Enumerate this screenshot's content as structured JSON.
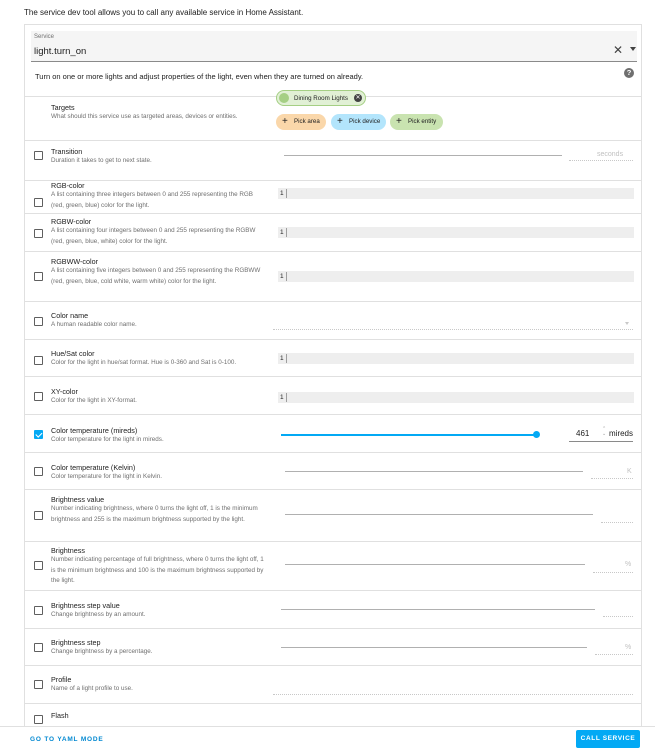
{
  "intro_text": "The service dev tool allows you to call any available service in Home Assistant.",
  "service": {
    "label": "Service",
    "value": "light.turn_on",
    "description": "Turn on one or more lights and adjust properties of the light, even when they are turned on already."
  },
  "targets": {
    "title": "Targets",
    "description": "What should this service use as targeted areas, devices or entities.",
    "selected_entity": "Dining Room Lights",
    "pick_area": "Pick area",
    "pick_device": "Pick device",
    "pick_entity": "Pick entity"
  },
  "fields": {
    "transition": {
      "title": "Transition",
      "description": "Duration it takes to get to next state.",
      "unit": "seconds",
      "checked": false
    },
    "rgb_color": {
      "title": "RGB-color",
      "description": "A list containing three integers between 0 and 255 representing the RGB (red, green, blue) color for the light.",
      "value": "1",
      "checked": false
    },
    "rgbw_color": {
      "title": "RGBW-color",
      "description": "A list containing four integers between 0 and 255 representing the RGBW (red, green, blue, white) color for the light.",
      "value": "1",
      "checked": false
    },
    "rgbww_color": {
      "title": "RGBWW-color",
      "description": "A list containing five integers between 0 and 255 representing the RGBWW (red, green, blue, cold white, warm white) color for the light.",
      "value": "1",
      "checked": false
    },
    "color_name": {
      "title": "Color name",
      "description": "A human readable color name.",
      "checked": false
    },
    "hs_color": {
      "title": "Hue/Sat color",
      "description": "Color for the light in hue/sat format. Hue is 0-360 and Sat is 0-100.",
      "value": "1",
      "checked": false
    },
    "xy_color": {
      "title": "XY-color",
      "description": "Color for the light in XY-format.",
      "value": "1",
      "checked": false
    },
    "color_temp": {
      "title": "Color temperature (mireds)",
      "description": "Color temperature for the light in mireds.",
      "value": "461",
      "unit": "mireds",
      "checked": true,
      "slider_fraction": 0.91
    },
    "kelvin": {
      "title": "Color temperature (Kelvin)",
      "description": "Color temperature for the light in Kelvin.",
      "unit": "K",
      "checked": false
    },
    "brightness": {
      "title": "Brightness value",
      "description": "Number indicating brightness, where 0 turns the light off, 1 is the minimum brightness and 255 is the maximum brightness supported by the light.",
      "checked": false
    },
    "brightness_pct": {
      "title": "Brightness",
      "description": "Number indicating percentage of full brightness, where 0 turns the light off, 1 is the minimum brightness and 100 is the maximum brightness supported by the light.",
      "unit": "%",
      "checked": false
    },
    "brightness_step": {
      "title": "Brightness step value",
      "description": "Change brightness by an amount.",
      "checked": false
    },
    "brightness_step_pct": {
      "title": "Brightness step",
      "description": "Change brightness by a percentage.",
      "unit": "%",
      "checked": false
    },
    "profile": {
      "title": "Profile",
      "description": "Name of a light profile to use.",
      "checked": false
    },
    "flash": {
      "title": "Flash",
      "checked": false
    }
  },
  "footer": {
    "yaml_mode": "GO TO YAML MODE",
    "call_service": "CALL SERVICE"
  },
  "colors": {
    "accent": "#03a9f4",
    "chip_entity": "#e1f0d5",
    "chip_area": "#fad7aa",
    "chip_device": "#b3e5fc",
    "chip_pick_entity": "#c9e3b0"
  }
}
